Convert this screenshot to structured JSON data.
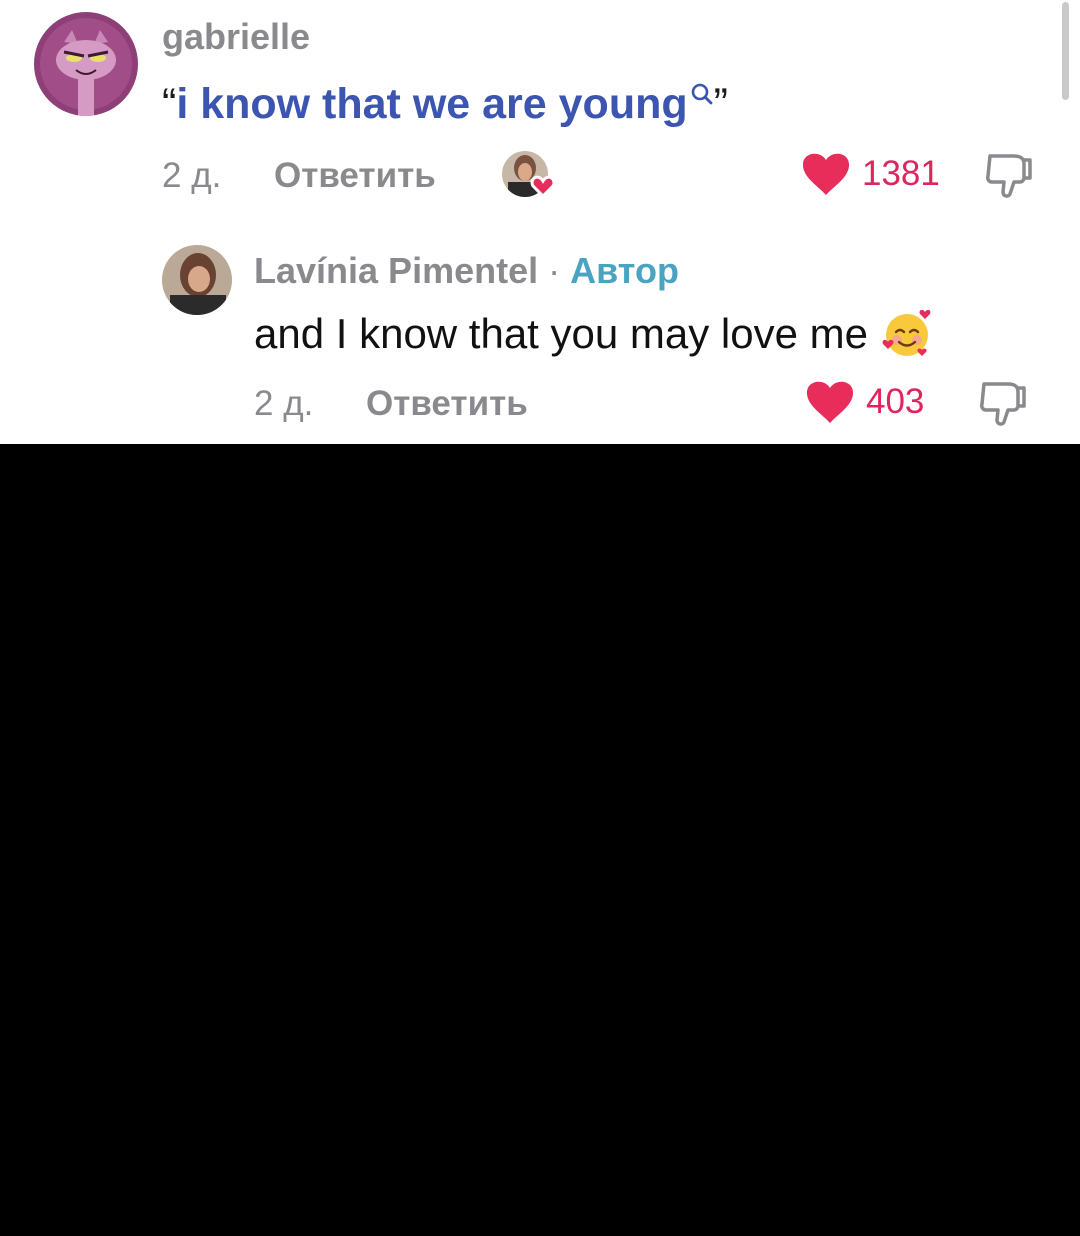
{
  "comments": [
    {
      "username": "gabrielle",
      "text": "i know that we are young",
      "quote_open": "“",
      "quote_close": "”",
      "age": "2 д.",
      "reply_label": "Ответить",
      "likes": "1381",
      "liked_by_creator": true,
      "icons": [
        "avatar",
        "search-icon",
        "creator-liked-avatar",
        "heart-icon",
        "dislike-icon"
      ]
    },
    {
      "username": "Lavínia Pimentel",
      "separator": "·",
      "badge": "Автор",
      "text": "and I know that you may love me",
      "emoji": "smiling-face-with-hearts",
      "age": "2 д.",
      "reply_label": "Ответить",
      "likes": "403",
      "icons": [
        "avatar",
        "heart-icon",
        "dislike-icon"
      ]
    }
  ],
  "colors": {
    "heart": "#e92d5b",
    "like_count": "#e0245e",
    "meta_gray": "#8a8a8e",
    "query_blue": "#3b55b0",
    "author_badge": "#4aa3c0",
    "background_lower": "#000000"
  }
}
